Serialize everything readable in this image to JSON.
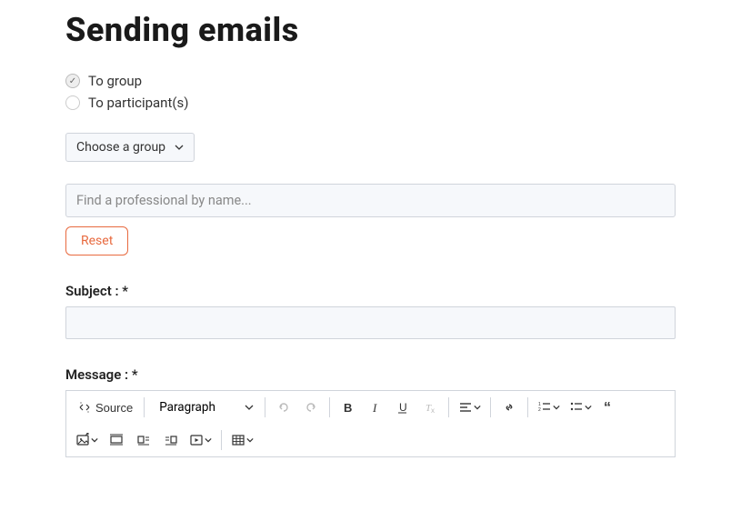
{
  "page": {
    "title": "Sending emails"
  },
  "recipients": {
    "group_option": "To group",
    "participants_option": "To participant(s)",
    "selected": "group"
  },
  "group_select": {
    "placeholder": "Choose a group"
  },
  "search": {
    "placeholder": "Find a professional by name..."
  },
  "actions": {
    "reset": "Reset"
  },
  "subject": {
    "label": "Subject : *",
    "value": ""
  },
  "message": {
    "label": "Message : *"
  },
  "editor": {
    "source_label": "Source",
    "heading_value": "Paragraph"
  }
}
